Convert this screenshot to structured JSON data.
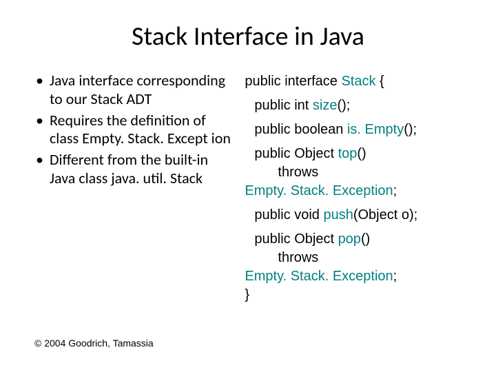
{
  "title": "Stack Interface in Java",
  "bullets": {
    "b1a": "Java interface corresponding to our Stack ADT",
    "b2a": "Requires the definition of class ",
    "b2b": "Empty. Stack. Except ion",
    "b3a": "Different from the built-in Java class ",
    "b3b": "java. util. Stack"
  },
  "code": {
    "l1a": "public interface ",
    "l1b": "Stack",
    "l1c": " {",
    "l2a": "public int ",
    "l2b": "size",
    "l2c": "();",
    "l3a": "public boolean ",
    "l3b": "is. Empty",
    "l3c": "();",
    "l4a": "public Object ",
    "l4b": "top",
    "l4c": "()",
    "l5": "throws",
    "l6a": "Empty. Stack. Exception",
    "l6b": ";",
    "l7a": "public void ",
    "l7b": "push",
    "l7c": "(Object o);",
    "l8a": "public Object ",
    "l8b": "pop",
    "l8c": "()",
    "l9": "throws",
    "l10a": "Empty. Stack. Exception",
    "l10b": ";",
    "l11": "}"
  },
  "footer": "© 2004 Goodrich, Tamassia"
}
